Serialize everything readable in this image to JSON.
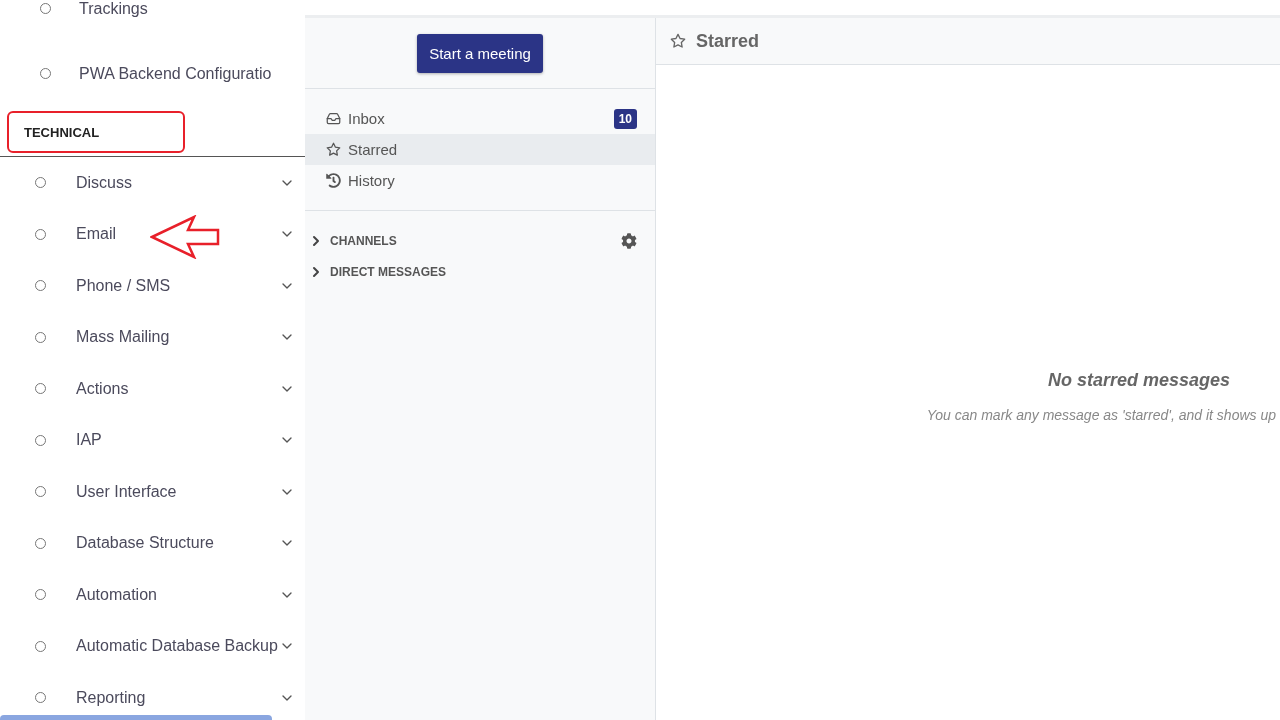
{
  "menu": {
    "items_top": [
      {
        "label": "Trackings",
        "expandable": false
      },
      {
        "label": "PWA Backend Configuratio",
        "expandable": false
      }
    ],
    "section": {
      "title": "TECHNICAL",
      "highlighted": true
    },
    "items": [
      {
        "label": "Discuss",
        "expandable": true,
        "pointed": false
      },
      {
        "label": "Email",
        "expandable": true,
        "pointed": true
      },
      {
        "label": "Phone / SMS",
        "expandable": true,
        "pointed": false
      },
      {
        "label": "Mass Mailing",
        "expandable": true,
        "pointed": false
      },
      {
        "label": "Actions",
        "expandable": true,
        "pointed": false
      },
      {
        "label": "IAP",
        "expandable": true,
        "pointed": false
      },
      {
        "label": "User Interface",
        "expandable": true,
        "pointed": false
      },
      {
        "label": "Database Structure",
        "expandable": true,
        "pointed": false
      },
      {
        "label": "Automation",
        "expandable": true,
        "pointed": false
      },
      {
        "label": "Automatic Database Backup",
        "expandable": true,
        "pointed": false
      },
      {
        "label": "Reporting",
        "expandable": true,
        "pointed": false
      }
    ]
  },
  "discuss": {
    "button": "Start a meeting",
    "mailboxes": [
      {
        "kind": "inbox",
        "label": "Inbox",
        "counter": "10",
        "selected": false
      },
      {
        "kind": "starred",
        "label": "Starred",
        "selected": true
      },
      {
        "kind": "history",
        "label": "History",
        "selected": false
      }
    ],
    "categories": [
      {
        "label": "CHANNELS",
        "settings": true
      },
      {
        "label": "DIRECT MESSAGES",
        "settings": false
      }
    ]
  },
  "thread": {
    "title": "Starred",
    "empty_title": "No starred messages",
    "empty_text": "You can mark any message as 'starred', and it shows up"
  }
}
